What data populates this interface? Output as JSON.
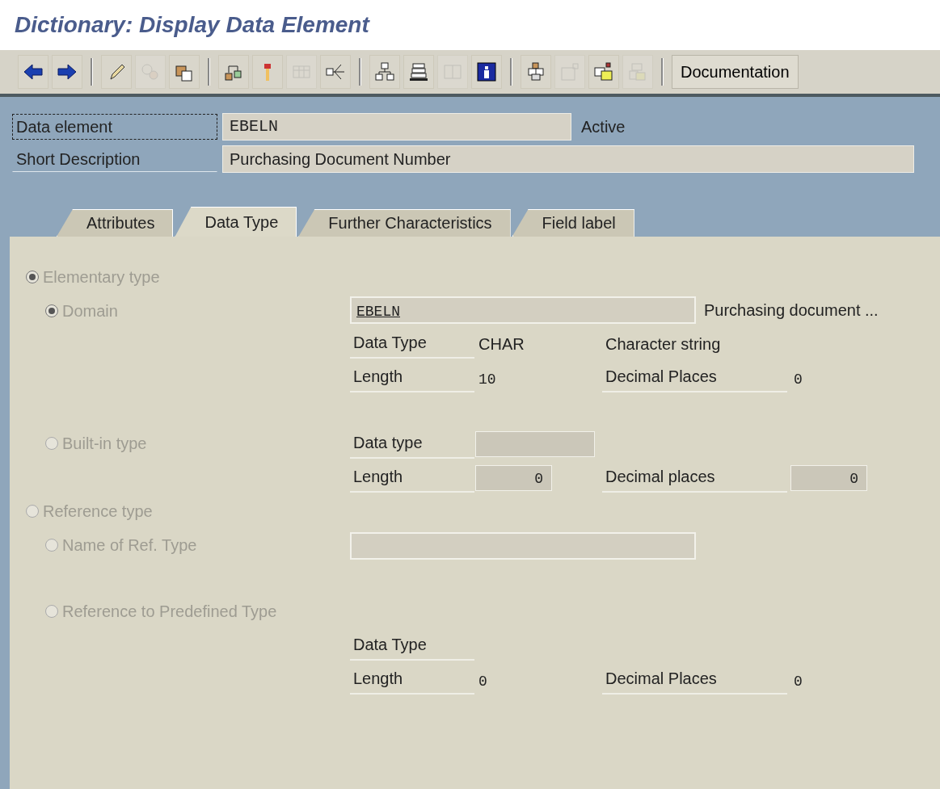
{
  "title": "Dictionary: Display Data Element",
  "toolbar": {
    "groups": [
      [
        {
          "disabled": false
        },
        {
          "disabled": false
        }
      ],
      [
        {
          "disabled": false
        },
        {
          "disabled": true
        },
        {
          "disabled": false
        }
      ],
      [
        {
          "disabled": false
        },
        {
          "disabled": false
        },
        {
          "disabled": true
        },
        {
          "disabled": false
        }
      ],
      [
        {
          "disabled": false
        },
        {
          "disabled": false
        },
        {
          "disabled": true
        },
        {
          "disabled": false
        }
      ],
      [
        {
          "disabled": false
        },
        {
          "disabled": true
        },
        {
          "disabled": false
        },
        {
          "disabled": true
        }
      ]
    ],
    "documentation_button": "Documentation"
  },
  "header": {
    "fields": [
      {
        "label": "Data element",
        "value": "EBELN",
        "status": "Active",
        "focused": true
      },
      {
        "label": "Short Description",
        "value": "Purchasing Document Number",
        "focused": false
      }
    ]
  },
  "tabs": [
    {
      "label": "Attributes",
      "selected": false
    },
    {
      "label": "Data Type",
      "selected": true
    },
    {
      "label": "Further Characteristics",
      "selected": false
    },
    {
      "label": "Field label",
      "selected": false
    }
  ],
  "rows": [
    {
      "radio": {
        "kind": "group",
        "label": "Elementary type",
        "selected": true
      }
    },
    {
      "radio": {
        "kind": "option",
        "label": "Domain",
        "selected": true
      },
      "cells": [
        {
          "kind": "wide_field",
          "text": "EBELN",
          "note": "Purchasing document ..."
        }
      ]
    },
    {
      "cells": [
        {
          "kind": "label",
          "text": "Data Type"
        },
        {
          "kind": "value",
          "text": "CHAR"
        },
        {
          "kind": "value",
          "text": "Character string"
        }
      ]
    },
    {
      "cells": [
        {
          "kind": "label",
          "text": "Length"
        },
        {
          "kind": "mono",
          "text": "10"
        },
        {
          "kind": "label",
          "text": "Decimal Places"
        },
        {
          "kind": "mono",
          "text": "0"
        }
      ]
    },
    {
      "radio": {
        "kind": "option",
        "label": "Built-in type",
        "selected": false
      },
      "cells": [
        {
          "kind": "label",
          "text": "Data type"
        },
        {
          "kind": "input"
        }
      ]
    },
    {
      "cells": [
        {
          "kind": "label",
          "text": "Length"
        },
        {
          "kind": "number_input",
          "text": "0"
        },
        {
          "kind": "label",
          "text": "Decimal places"
        },
        {
          "kind": "number_input",
          "text": "0"
        }
      ]
    },
    {
      "radio": {
        "kind": "group",
        "label": "Reference type",
        "selected": false
      }
    },
    {
      "radio": {
        "kind": "option",
        "label": "Name of Ref. Type",
        "selected": false
      },
      "cells": [
        {
          "kind": "wide_field"
        }
      ]
    },
    {
      "radio": {
        "kind": "option",
        "label": "Reference to Predefined Type",
        "selected": false
      }
    },
    {
      "cells": [
        {
          "kind": "label",
          "text": "Data Type"
        }
      ]
    },
    {
      "cells": [
        {
          "kind": "label",
          "text": "Length"
        },
        {
          "kind": "mono",
          "text": "0"
        },
        {
          "kind": "label",
          "text": "Decimal Places"
        },
        {
          "kind": "mono",
          "text": "0"
        }
      ]
    }
  ]
}
